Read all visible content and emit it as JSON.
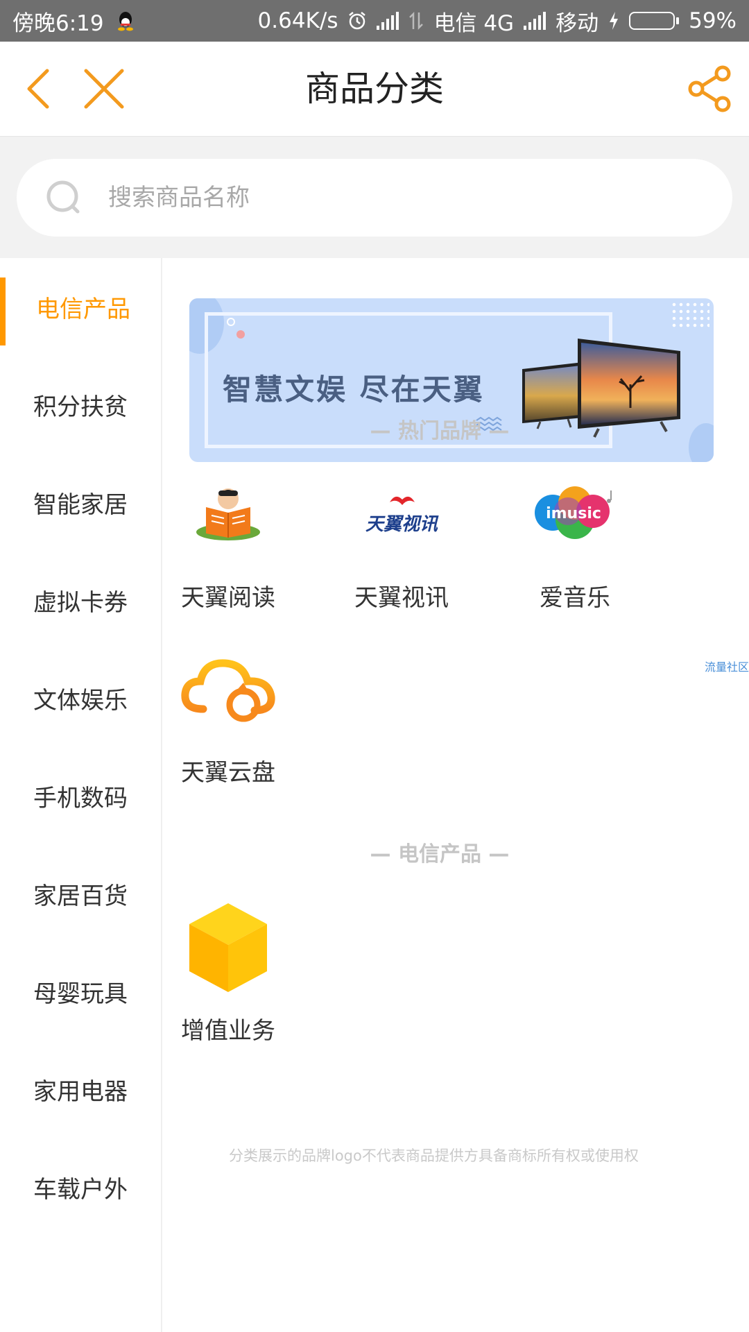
{
  "status_bar": {
    "time": "傍晚6:19",
    "speed": "0.64K/s",
    "carrier1": "电信 4G",
    "carrier2": "移动",
    "battery": "59%",
    "battery_level": 0.59
  },
  "header": {
    "title": "商品分类",
    "back_icon": "chevron-left-icon",
    "close_icon": "close-icon",
    "share_icon": "share-icon",
    "accent_color": "#F39A1E"
  },
  "search": {
    "placeholder": "搜索商品名称",
    "value": ""
  },
  "sidebar": {
    "active_color": "#FF9800",
    "items": [
      {
        "label": "电信产品",
        "active": true
      },
      {
        "label": "积分扶贫",
        "active": false
      },
      {
        "label": "智能家居",
        "active": false
      },
      {
        "label": "虚拟卡券",
        "active": false
      },
      {
        "label": "文体娱乐",
        "active": false
      },
      {
        "label": "手机数码",
        "active": false
      },
      {
        "label": "家居百货",
        "active": false
      },
      {
        "label": "母婴玩具",
        "active": false
      },
      {
        "label": "家用电器",
        "active": false
      },
      {
        "label": "车载户外",
        "active": false
      }
    ]
  },
  "banner": {
    "text": "智慧文娱 尽在天翼"
  },
  "hot_brands": {
    "title": "— 热门品牌 —",
    "items": [
      {
        "label": "天翼阅读",
        "icon": "reading-person-icon"
      },
      {
        "label": "天翼视讯",
        "icon": "tianyi-video-logo",
        "logo_text": "天翼视讯"
      },
      {
        "label": "爱音乐",
        "icon": "imusic-logo",
        "logo_text": "imusic"
      },
      {
        "label": "天翼云盘",
        "icon": "cloud-sync-icon"
      }
    ],
    "side_tag": "流量社区"
  },
  "telecom_products": {
    "title": "— 电信产品 —",
    "items": [
      {
        "label": "增值业务",
        "icon": "yellow-cube-icon"
      }
    ]
  },
  "disclaimer": "分类展示的品牌logo不代表商品提供方具备商标所有权或使用权"
}
